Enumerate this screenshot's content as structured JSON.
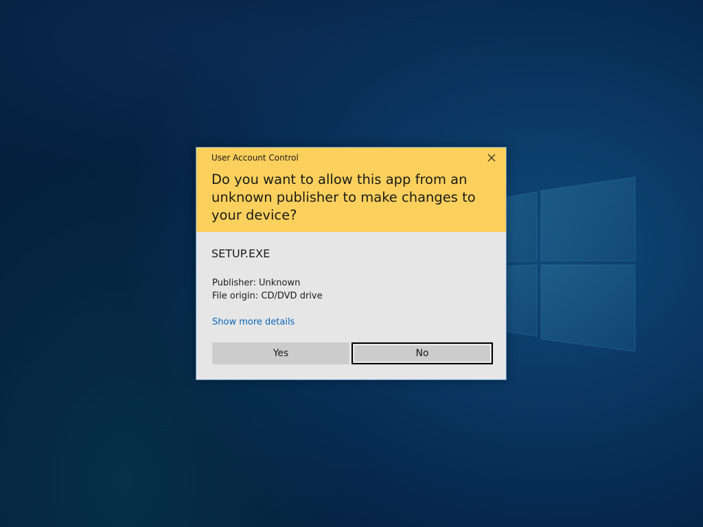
{
  "desktop": {
    "background_color": "#0b3a66"
  },
  "dialog": {
    "title": "User Account Control",
    "question": "Do you want to allow this app from an unknown publisher to make changes to your device?",
    "app_name": "SETUP.EXE",
    "publisher": "Publisher: Unknown",
    "file_origin": "File origin: CD/DVD drive",
    "details_link": "Show more details",
    "yes_label": "Yes",
    "no_label": "No",
    "close_icon": "close-icon",
    "header_color": "#fcd05c",
    "body_color": "#e6e6e6",
    "link_color": "#0a66b8",
    "focused_button": "No"
  }
}
